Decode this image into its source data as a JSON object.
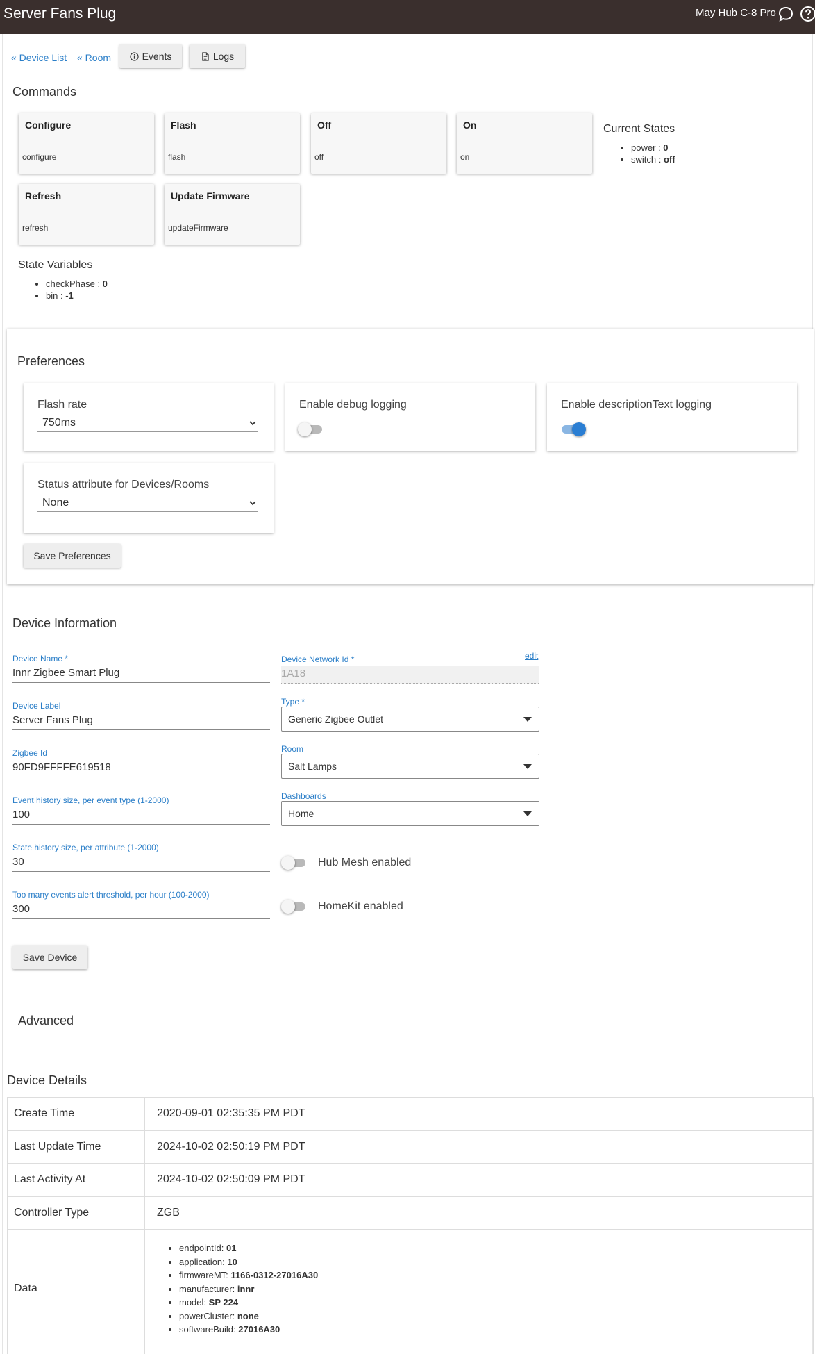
{
  "header": {
    "title": "Server Fans Plug",
    "hub_name": "May Hub C-8 Pro"
  },
  "nav": {
    "device_list": "« Device List",
    "room": "« Room",
    "events": "Events",
    "logs": "Logs"
  },
  "commands": {
    "heading": "Commands",
    "items": [
      {
        "name": "Configure",
        "method": "configure"
      },
      {
        "name": "Flash",
        "method": "flash"
      },
      {
        "name": "Off",
        "method": "off"
      },
      {
        "name": "On",
        "method": "on"
      },
      {
        "name": "Refresh",
        "method": "refresh"
      },
      {
        "name": "Update Firmware",
        "method": "updateFirmware"
      }
    ]
  },
  "current_states": {
    "heading": "Current States",
    "items": [
      {
        "key": "power",
        "value": "0"
      },
      {
        "key": "switch",
        "value": "off"
      }
    ]
  },
  "state_variables": {
    "heading": "State Variables",
    "items": [
      {
        "key": "checkPhase",
        "value": "0"
      },
      {
        "key": "bin",
        "value": "-1"
      }
    ]
  },
  "preferences": {
    "heading": "Preferences",
    "flash_rate": {
      "label": "Flash rate",
      "value": "750ms"
    },
    "debug_logging": {
      "label": "Enable debug logging",
      "enabled": false
    },
    "desc_logging": {
      "label": "Enable descriptionText logging",
      "enabled": true
    },
    "status_attribute": {
      "label": "Status attribute for Devices/Rooms",
      "value": "None"
    },
    "save_label": "Save Preferences"
  },
  "device_info": {
    "heading": "Device Information",
    "device_name": {
      "label": "Device Name *",
      "value": "Innr Zigbee Smart Plug"
    },
    "network_id": {
      "label": "Device Network Id *",
      "value": "1A18",
      "edit": "edit"
    },
    "device_label": {
      "label": "Device Label",
      "value": "Server Fans Plug"
    },
    "type": {
      "label": "Type *",
      "value": "Generic Zigbee Outlet"
    },
    "zigbee_id": {
      "label": "Zigbee Id",
      "value": "90FD9FFFFE619518"
    },
    "room": {
      "label": "Room",
      "value": "Salt Lamps"
    },
    "event_history": {
      "label": "Event history size, per event type (1-2000)",
      "value": "100"
    },
    "dashboards": {
      "label": "Dashboards",
      "value": "Home"
    },
    "state_history": {
      "label": "State history size, per attribute (1-2000)",
      "value": "30"
    },
    "hub_mesh": {
      "label": "Hub Mesh enabled",
      "enabled": false
    },
    "too_many_events": {
      "label": "Too many events alert threshold, per hour (100-2000)",
      "value": "300"
    },
    "homekit": {
      "label": "HomeKit enabled",
      "enabled": false
    },
    "save_label": "Save Device"
  },
  "advanced": {
    "heading": "Advanced"
  },
  "device_details": {
    "heading": "Device Details",
    "rows": [
      {
        "key": "Create Time",
        "value": "2020-09-01 02:35:35 PM PDT"
      },
      {
        "key": "Last Update Time",
        "value": "2024-10-02 02:50:19 PM PDT"
      },
      {
        "key": "Last Activity At",
        "value": "2024-10-02 02:50:09 PM PDT"
      },
      {
        "key": "Controller Type",
        "value": "ZGB"
      }
    ],
    "data_label": "Data",
    "data_items": [
      {
        "key": "endpointId",
        "value": "01"
      },
      {
        "key": "application",
        "value": "10"
      },
      {
        "key": "firmwareMT",
        "value": "1166-0312-27016A30"
      },
      {
        "key": "manufacturer",
        "value": "innr"
      },
      {
        "key": "model",
        "value": "SP 224"
      },
      {
        "key": "powerCluster",
        "value": "none"
      },
      {
        "key": "softwareBuild",
        "value": "27016A30"
      }
    ]
  },
  "colors": {
    "topbar": "#3a2f2d",
    "link": "#2a7ec8",
    "toggle_on": "#2a7ed3"
  }
}
